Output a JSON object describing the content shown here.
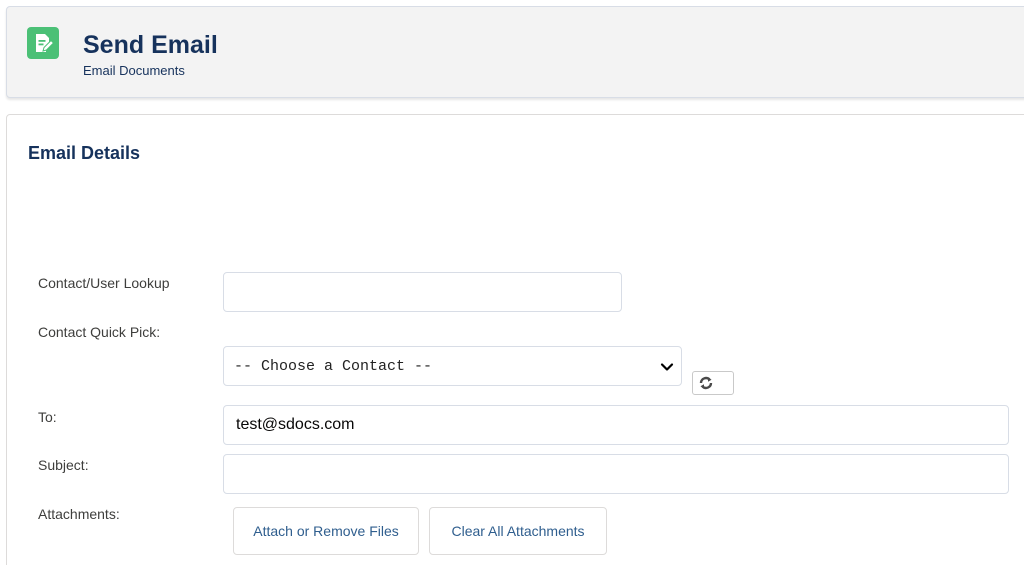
{
  "header": {
    "icon": "document-edit-icon",
    "title": "Send Email",
    "subtitle": "Email Documents",
    "icon_color": "#4bc076",
    "title_color": "#16325c"
  },
  "section": {
    "title": "Email Details"
  },
  "fields": {
    "contact_lookup": {
      "label": "Contact/User Lookup",
      "value": ""
    },
    "quick_pick": {
      "label": "Contact Quick Pick:",
      "selected": "-- Choose a Contact --",
      "refresh_icon": "refresh-icon"
    },
    "to": {
      "label": "To:",
      "value": "test@sdocs.com"
    },
    "subject": {
      "label": "Subject:",
      "value": ""
    },
    "attachments": {
      "label": "Attachments:"
    }
  },
  "buttons": {
    "attach_remove": "Attach or Remove Files",
    "clear_all": "Clear All Attachments"
  },
  "colors": {
    "link_blue": "#2f5e8e",
    "border": "#d8dde6"
  }
}
